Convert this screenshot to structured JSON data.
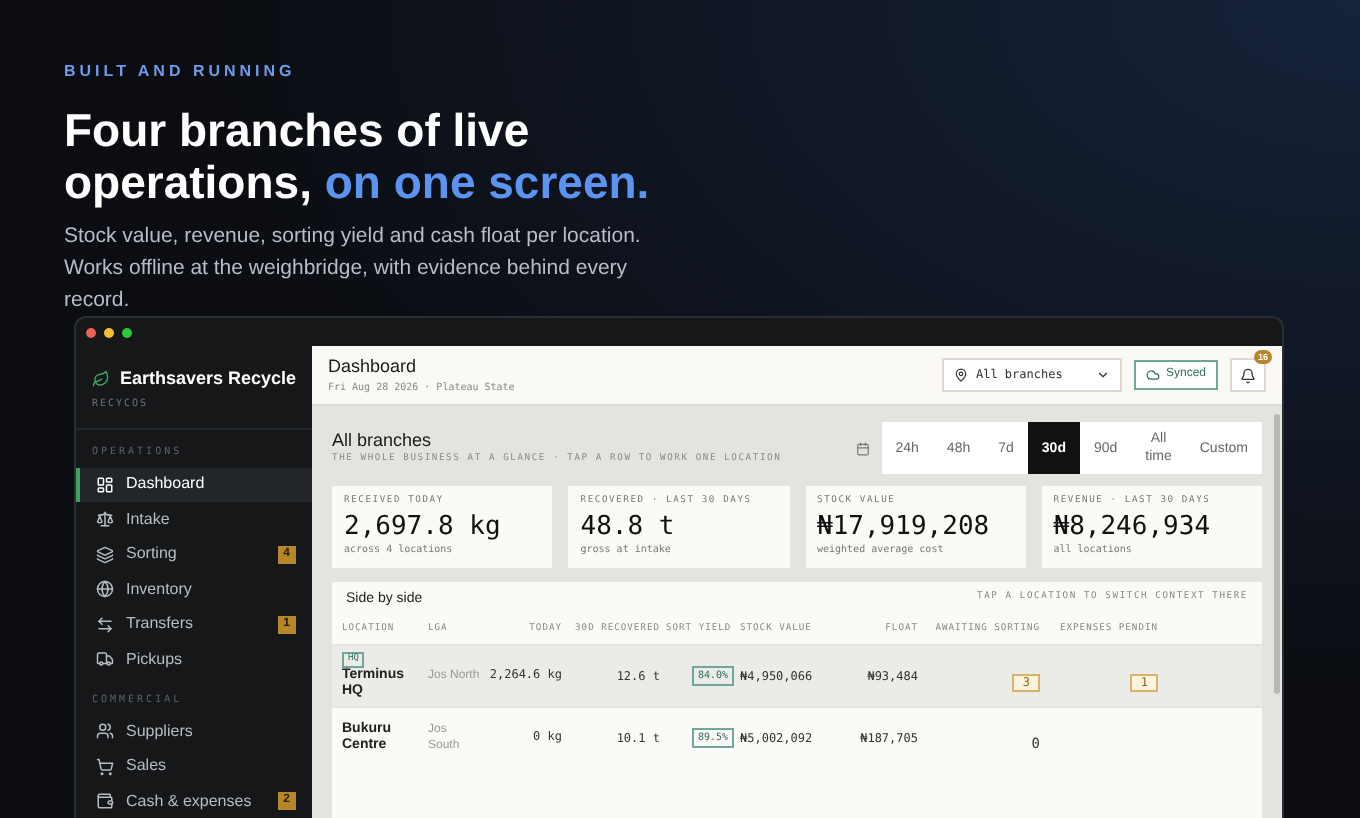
{
  "eyebrow": "BUILT AND RUNNING",
  "headline": {
    "text": "Four branches of live operations,",
    "highlight": "on one screen."
  },
  "subhead": "Stock value, revenue, sorting yield and cash float per location. Works offline at the weighbridge, with evidence behind every record.",
  "sidebar": {
    "brand": "Earthsavers Recycle",
    "subtitle": "RECYCOS",
    "sections": [
      {
        "title": "OPERATIONS",
        "items": [
          {
            "label": "Dashboard",
            "selected": true
          },
          {
            "label": "Intake",
            "selected": false
          },
          {
            "label": "Sorting",
            "selected": false,
            "badge": "4"
          },
          {
            "label": "Inventory",
            "selected": false
          },
          {
            "label": "Transfers",
            "selected": false,
            "badge": "1"
          },
          {
            "label": "Pickups",
            "selected": false
          }
        ]
      },
      {
        "title": "COMMERCIAL",
        "items": [
          {
            "label": "Suppliers",
            "selected": false
          },
          {
            "label": "Sales",
            "selected": false
          },
          {
            "label": "Cash & expenses",
            "selected": false,
            "badge": "2"
          }
        ]
      }
    ]
  },
  "header": {
    "title": "Dashboard",
    "subtitle": "Fri Aug 28 2026 · Plateau State",
    "branch_select": "All branches",
    "sync": "Synced",
    "notifications": "16"
  },
  "scope": {
    "title": "All branches",
    "subtitle": "THE WHOLE BUSINESS AT A GLANCE · TAP A ROW TO WORK ONE LOCATION",
    "ranges": [
      {
        "label": "24h",
        "selected": false
      },
      {
        "label": "48h",
        "selected": false
      },
      {
        "label": "7d",
        "selected": false
      },
      {
        "label": "30d",
        "selected": true
      },
      {
        "label": "90d",
        "selected": false
      },
      {
        "label": "All time",
        "selected": false
      },
      {
        "label": "Custom",
        "selected": false
      }
    ]
  },
  "kpis": [
    {
      "label": "RECEIVED TODAY",
      "value": "2,697.8 kg",
      "note": "across 4 locations"
    },
    {
      "label": "RECOVERED · LAST 30 DAYS",
      "value": "48.8 t",
      "note": "gross at intake"
    },
    {
      "label": "STOCK VALUE",
      "value": "₦17,919,208",
      "note": "weighted average cost"
    },
    {
      "label": "REVENUE · LAST 30 DAYS",
      "value": "₦8,246,934",
      "note": "all locations"
    }
  ],
  "table": {
    "title": "Side by side",
    "hint": "TAP A LOCATION TO SWITCH CONTEXT THERE",
    "columns": [
      "LOCATION",
      "LGA",
      "TODAY",
      "30D RECOVERED",
      "SORT YIELD",
      "STOCK VALUE",
      "FLOAT",
      "AWAITING SORTING",
      "EXPENSES PENDIN"
    ],
    "rows": [
      {
        "tag": "HQ",
        "location": "Terminus HQ",
        "lga": "Jos North",
        "today": "2,264.6 kg",
        "recovered": "12.6 t",
        "sort_yield": "84.0%",
        "stock_value": "₦4,950,066",
        "float": "₦93,484",
        "awaiting": {
          "text": "3",
          "flagged": true
        },
        "expenses": {
          "text": "1",
          "flagged": true
        }
      },
      {
        "location": "Bukuru Centre",
        "lga": "Jos South",
        "today": "0 kg",
        "recovered": "10.1 t",
        "sort_yield": "89.5%",
        "stock_value": "₦5,002,092",
        "float": "₦187,705",
        "awaiting": {
          "text": "0",
          "flagged": false
        }
      }
    ]
  }
}
